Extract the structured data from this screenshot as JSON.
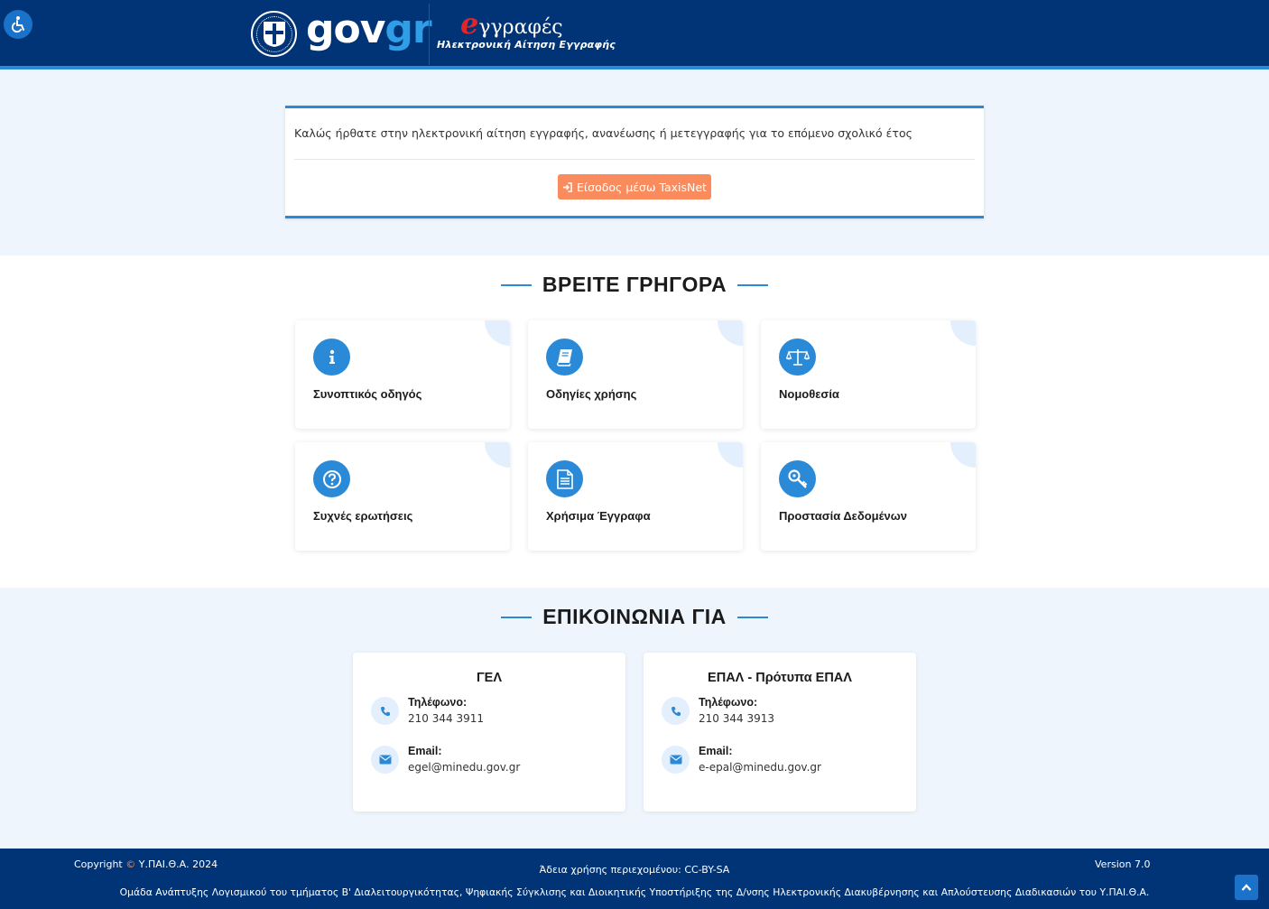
{
  "header": {
    "accessibility_icon": "wheelchair-icon",
    "logo_gov": "gov",
    "logo_gr": "gr",
    "app_logo_e": "e",
    "app_logo_rest": "γγραφές",
    "app_subtitle": "Ηλεκτρονική Αίτηση Εγγραφής"
  },
  "welcome": {
    "text": "Καλώς ήρθατε στην ηλεκτρονική αίτηση εγγραφής, ανανέωσης ή μετεγγραφής για το επόμενο σχολικό έτος",
    "login_button": "Είσοδος μέσω TaxisNet",
    "login_icon": "sign-in-icon"
  },
  "quick_find": {
    "title": "ΒΡΕΙΤΕ ΓΡΗΓΟΡΑ",
    "items": [
      {
        "label": "Συνοπτικός οδηγός",
        "icon": "info-icon"
      },
      {
        "label": "Οδηγίες χρήσης",
        "icon": "book-icon"
      },
      {
        "label": "Νομοθεσία",
        "icon": "balance-scale-icon"
      },
      {
        "label": "Συχνές ερωτήσεις",
        "icon": "question-icon"
      },
      {
        "label": "Χρήσιμα Έγγραφα",
        "icon": "document-icon"
      },
      {
        "label": "Προστασία Δεδομένων",
        "icon": "key-icon"
      }
    ]
  },
  "contact": {
    "title": "ΕΠΙΚΟΙΝΩΝΙΑ ΓΙΑ",
    "cards": [
      {
        "title": "ΓΕΛ",
        "phone_label": "Τηλέφωνο:",
        "phone": "210 344 3911",
        "email_label": "Email:",
        "email": "egel@minedu.gov.gr"
      },
      {
        "title": "ΕΠΑΛ - Πρότυπα ΕΠΑΛ",
        "phone_label": "Τηλέφωνο:",
        "phone": "210 344 3913",
        "email_label": "Email:",
        "email": "e-epal@minedu.gov.gr"
      }
    ]
  },
  "footer": {
    "copyright_prefix": "Copyright ",
    "copyright_symbol": "©",
    "copyright_suffix": " Υ.ΠΑΙ.Θ.Α. 2024",
    "license": "Άδεια χρήσης περιεχομένου: CC-BY-SA",
    "version": "Version 7.0",
    "team": "Ομάδα Ανάπτυξης Λογισμικού του τμήματος Β' Διαλειτουργικότητας, Ψηφιακής Σύγκλισης και Διοικητικής Υποστήριξης της Δ/νσης Ηλεκτρονικής Διακυβέρνησης και Απλούστευσης Διαδικασιών του Υ.ΠΑΙ.Θ.Α."
  },
  "colors": {
    "header_bg": "#003476",
    "accent_blue": "#2b8ad8",
    "button_orange": "#f98b5c",
    "band_bg": "#eef5fd"
  }
}
